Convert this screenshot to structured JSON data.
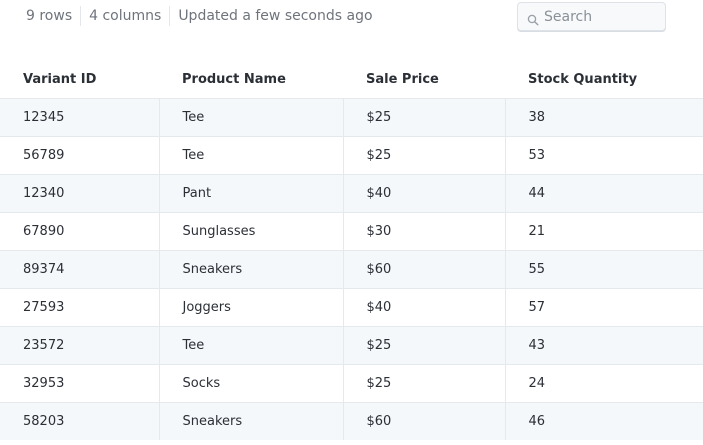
{
  "meta": {
    "rows": "9 rows",
    "columns": "4 columns",
    "updated": "Updated a few seconds ago"
  },
  "search": {
    "placeholder": "Search",
    "icon": "search-icon"
  },
  "table": {
    "headers": [
      "Variant ID",
      "Product Name",
      "Sale Price",
      "Stock Quantity"
    ],
    "rows": [
      [
        "12345",
        "Tee",
        "$25",
        "38"
      ],
      [
        "56789",
        "Tee",
        "$25",
        "53"
      ],
      [
        "12340",
        "Pant",
        "$40",
        "44"
      ],
      [
        "67890",
        "Sunglasses",
        "$30",
        "21"
      ],
      [
        "89374",
        "Sneakers",
        "$60",
        "55"
      ],
      [
        "27593",
        "Joggers",
        "$40",
        "57"
      ],
      [
        "23572",
        "Tee",
        "$25",
        "43"
      ],
      [
        "32953",
        "Socks",
        "$25",
        "24"
      ],
      [
        "58203",
        "Sneakers",
        "$60",
        "46"
      ]
    ]
  },
  "colors": {
    "stripe": "#f5f8fa",
    "border": "#e5e8ec",
    "muted_text": "#6f747c"
  }
}
